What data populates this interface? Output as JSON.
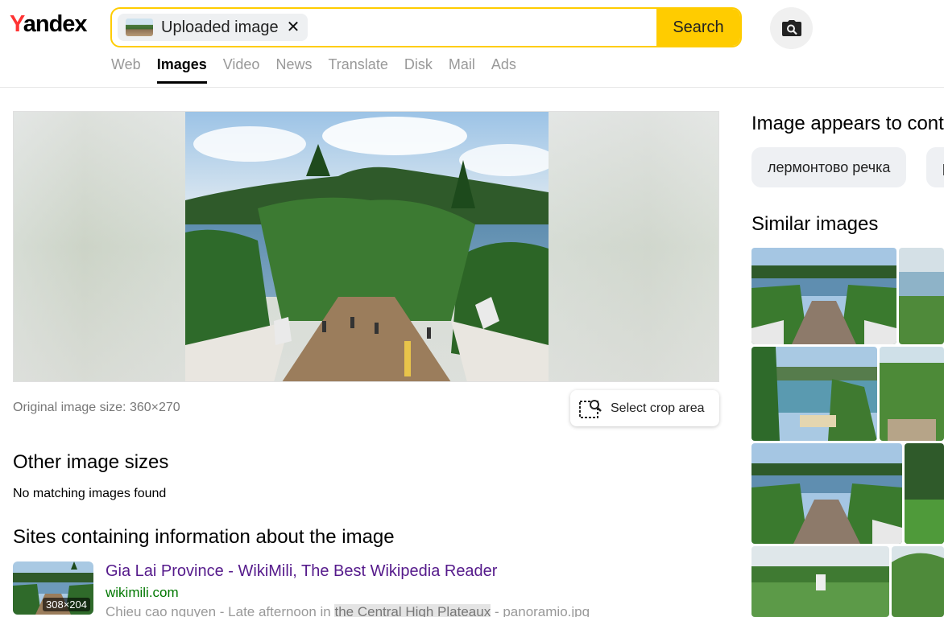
{
  "header": {
    "logo_y": "Y",
    "logo_rest": "andex",
    "search_chip_label": "Uploaded image",
    "search_button": "Search",
    "nav": [
      {
        "label": "Web"
      },
      {
        "label": "Images",
        "active": true
      },
      {
        "label": "Video"
      },
      {
        "label": "News"
      },
      {
        "label": "Translate"
      },
      {
        "label": "Disk"
      },
      {
        "label": "Mail"
      },
      {
        "label": "Ads"
      }
    ]
  },
  "main": {
    "original_size": "Original image size: 360×270",
    "crop_button": "Select crop area",
    "other_sizes_heading": "Other image sizes",
    "no_match": "No matching images found",
    "sites_heading": "Sites containing information about the image",
    "site": {
      "title": "Gia Lai Province - WikiMili, The Best Wikipedia Reader",
      "url": "wikimili.com",
      "snippet_before": "Chieu cao nguyen - Late afternoon in ",
      "snippet_highlight": "the Central High Plateaux",
      "snippet_after": " - panoramio.jpg",
      "thumb_size": "308×204"
    }
  },
  "sidebar": {
    "appears_heading": "Image appears to contain",
    "tags": [
      "лермонтово речка",
      "р"
    ],
    "similar_heading": "Similar images"
  },
  "colors": {
    "accent": "#ffcc00",
    "link": "#551a8b",
    "url": "#007700",
    "logo_red": "#ff3333"
  }
}
